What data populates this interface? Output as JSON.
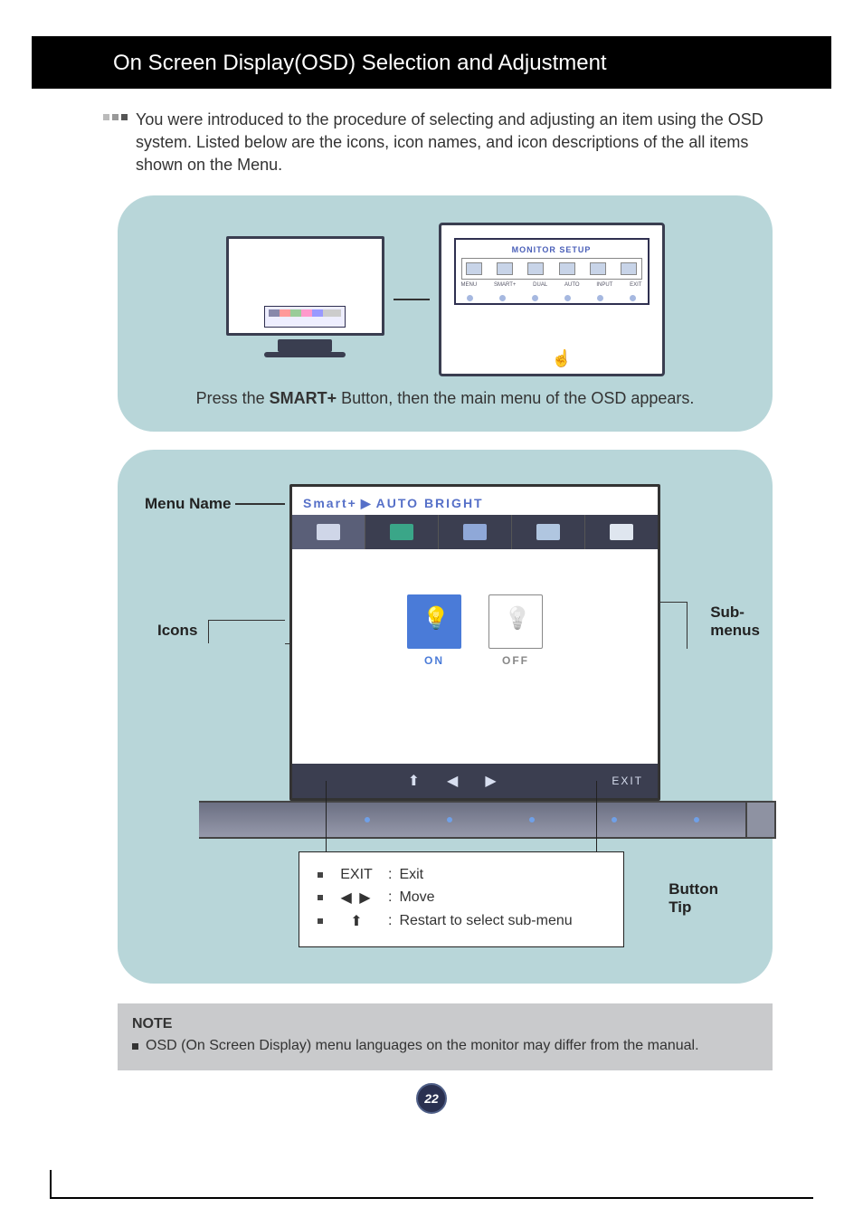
{
  "header": {
    "title": "On Screen Display(OSD) Selection and Adjustment"
  },
  "intro": "You were introduced to the procedure of selecting and adjusting an item using the OSD system. Listed below are the icons, icon names, and icon descriptions of the all items shown on the Menu.",
  "panel1": {
    "osd_title": "MONITOR SETUP",
    "labels": [
      "MENU",
      "SMART+",
      "DUAL",
      "AUTO",
      "INPUT",
      "EXIT"
    ],
    "instruction_pre": "Press the ",
    "instruction_bold": "SMART+",
    "instruction_post": " Button, then the main menu of the OSD appears."
  },
  "panel2": {
    "label_menu": "Menu Name",
    "label_icons": "Icons",
    "label_sub1": "Sub-",
    "label_sub2": "menus",
    "label_button": "Button",
    "label_tip": "Tip",
    "breadcrumb_left": "Smart+",
    "breadcrumb_right": "AUTO BRIGHT",
    "opt_on": "ON",
    "opt_off": "OFF",
    "nav_exit": "EXIT",
    "tips": {
      "row1_key": "EXIT",
      "row1_val": "Exit",
      "row2_key": "◀ ▶",
      "row2_val": "Move",
      "row3_key": "⬆",
      "row3_val": "Restart to select sub-menu"
    }
  },
  "note": {
    "title": "NOTE",
    "text": "OSD (On Screen Display) menu languages on the monitor may differ from the manual."
  },
  "page_number": "22"
}
